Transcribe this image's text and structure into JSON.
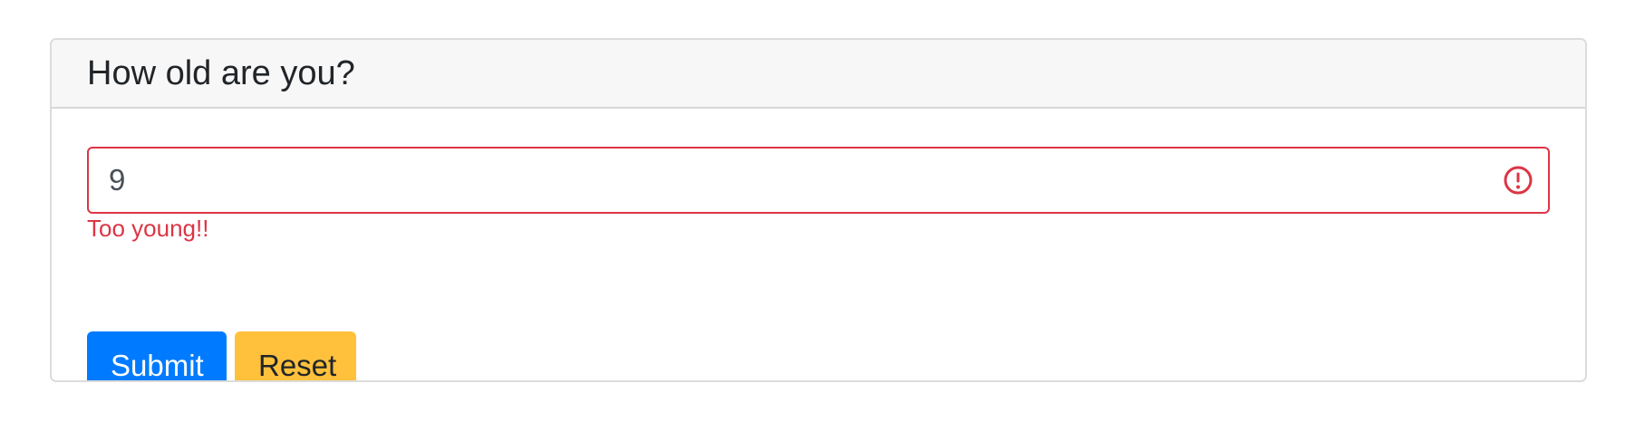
{
  "card": {
    "title": "How old are you?"
  },
  "age_field": {
    "value": "9",
    "state": "invalid",
    "feedback": "Too young!!"
  },
  "buttons": {
    "submit_label": "Submit",
    "reset_label": "Reset"
  },
  "icons": {
    "invalid": "exclamation-circle-icon"
  },
  "colors": {
    "danger": "#dc3545",
    "primary": "#007bff",
    "warning": "#ffc13c"
  }
}
